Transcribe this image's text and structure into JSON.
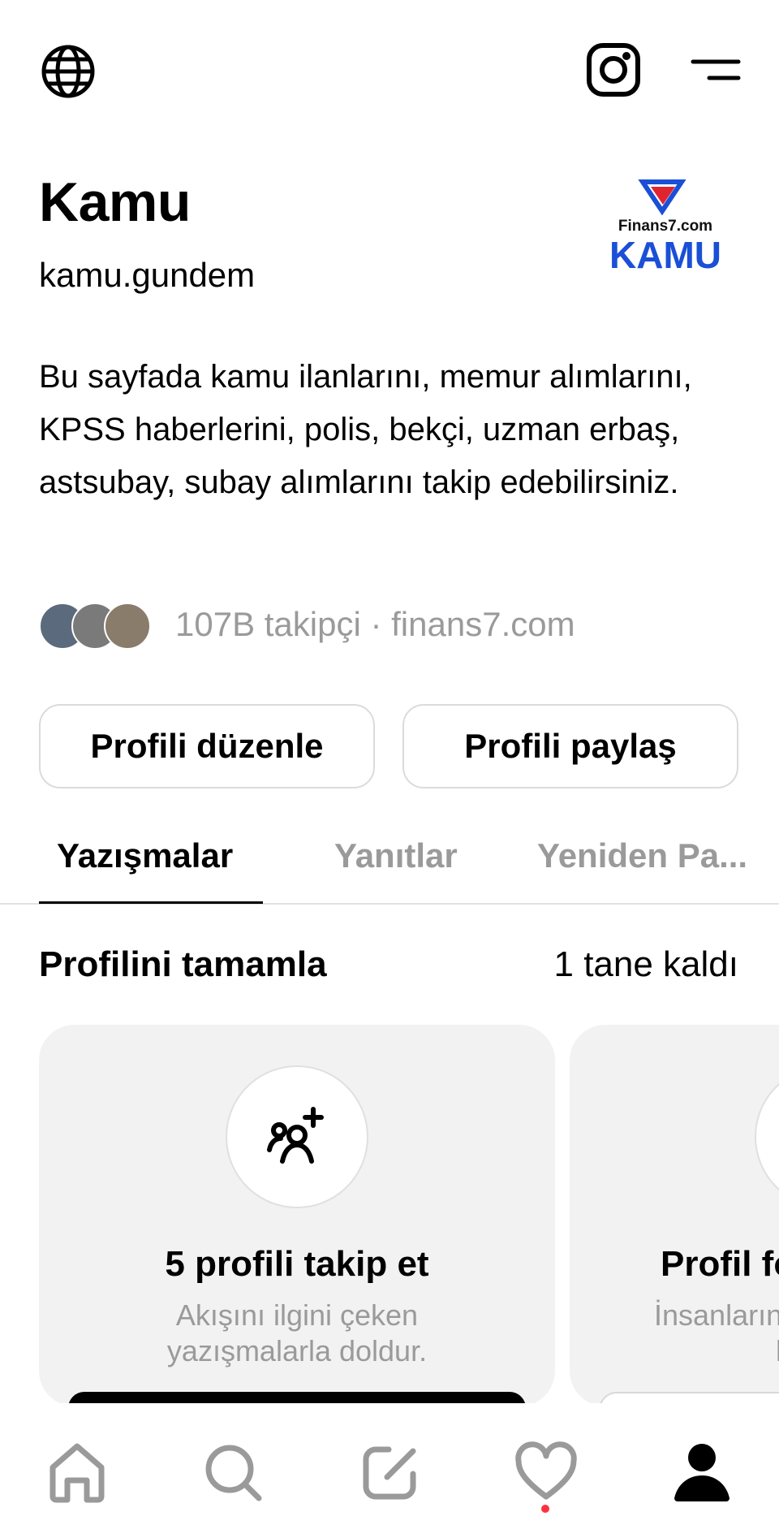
{
  "profile": {
    "name": "Kamu",
    "handle": "kamu.gundem",
    "bio": "Bu sayfada kamu ilanlarını, memur alımlarını, KPSS haberlerini, polis, bekçi, uzman erbaş, astsubay, subay alımlarını takip edebilirsiniz.",
    "followers_line": "107B takipçi · finans7.com",
    "logo": {
      "top_text": "Finans7.com",
      "main_text": "KAMU",
      "color_blue": "#1a4fd6",
      "color_red": "#e0242f"
    }
  },
  "buttons": {
    "edit": "Profili düzenle",
    "share": "Profili paylaş"
  },
  "tabs": [
    {
      "label": "Yazışmalar",
      "active": true
    },
    {
      "label": "Yanıtlar",
      "active": false
    },
    {
      "label": "Yeniden Pa...",
      "active": false
    }
  ],
  "complete_profile": {
    "title": "Profilini tamamla",
    "remaining": "1 tane kaldı",
    "cards": [
      {
        "icon": "add-people-icon",
        "title": "5 profili takip et",
        "desc_line1": "Akışını ilgini çeken",
        "desc_line2": "yazışmalarla doldur."
      },
      {
        "icon": "profile-photo-icon",
        "title": "Profil fo",
        "desc_line1": "İnsanların",
        "desc_line2": "ko"
      }
    ]
  },
  "bottom_nav": [
    "home-icon",
    "search-icon",
    "compose-icon",
    "activity-heart-icon",
    "profile-icon"
  ],
  "colors": {
    "accent_dot": "#ff3040",
    "muted": "#9a9a9a"
  }
}
